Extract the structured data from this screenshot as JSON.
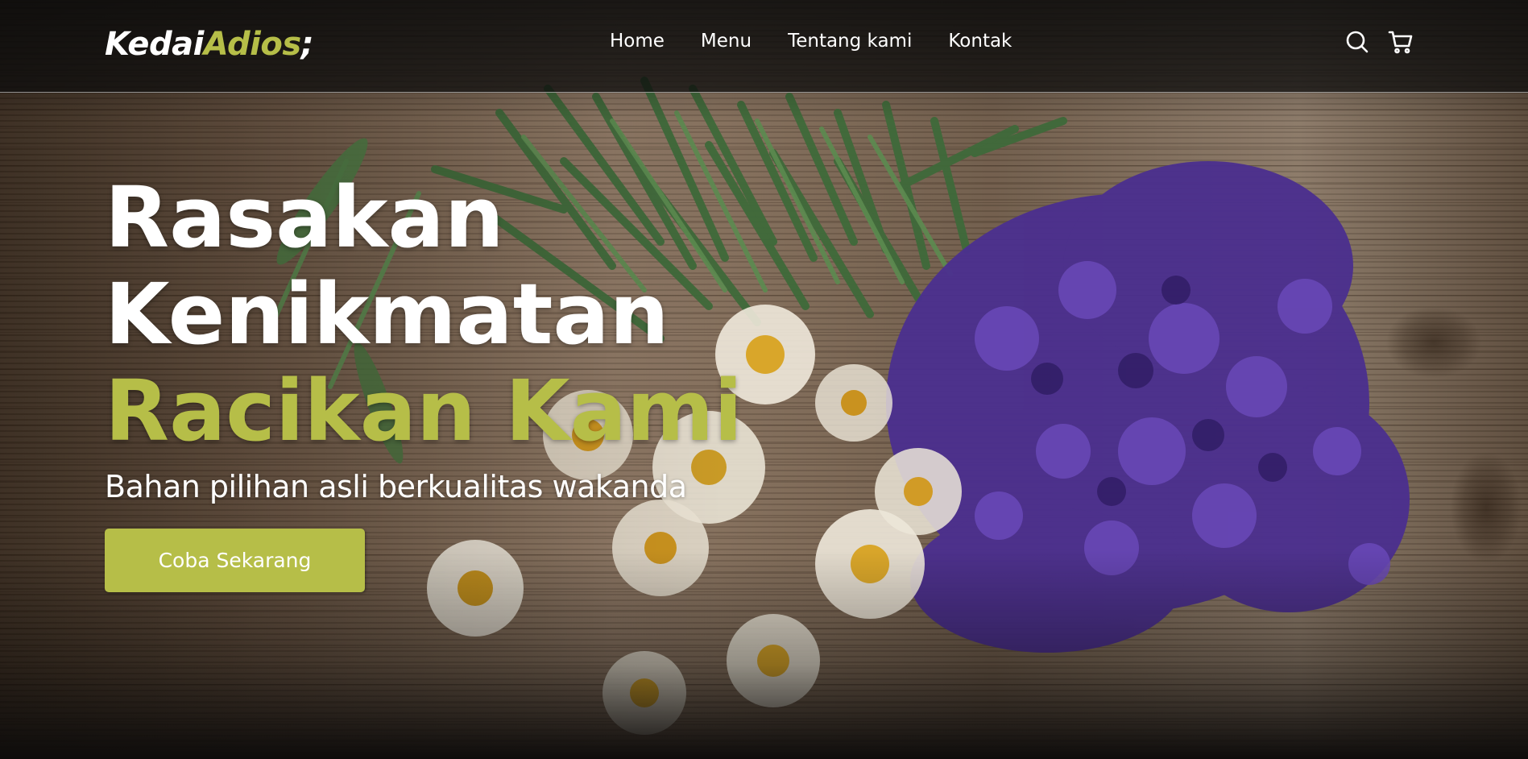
{
  "brand": {
    "name_part1": "Kedai",
    "name_part2": "Adios",
    "name_suffix": ";"
  },
  "navbar": {
    "links": [
      {
        "label": "Home"
      },
      {
        "label": "Menu"
      },
      {
        "label": "Tentang kami"
      },
      {
        "label": "Kontak"
      }
    ],
    "icons": [
      "search-icon",
      "shopping-cart-icon"
    ]
  },
  "hero": {
    "headline_line1": "Rasakan",
    "headline_line2": "Kenikmatan",
    "headline_line3": "Racikan Kami",
    "subtitle": "Bahan pilihan asli berkualitas wakanda",
    "cta_label": "Coba Sekarang",
    "background": "dried herbs, chamomile flowers and purple petals on a wooden table"
  },
  "colors": {
    "accent": "#b6be48",
    "navbar_bg": "#0c0c0c",
    "text": "#ffffff"
  }
}
